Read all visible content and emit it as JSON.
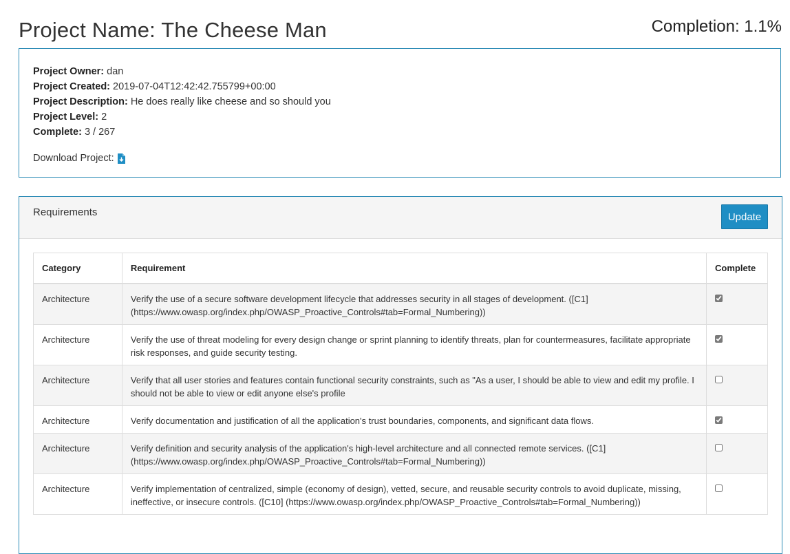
{
  "header": {
    "project_name": "Project Name: The Cheese Man",
    "completion": "Completion: 1.1%"
  },
  "project_info": {
    "owner_label": "Project Owner:",
    "owner_value": "dan",
    "created_label": "Project Created:",
    "created_value": "2019-07-04T12:42:42.755799+00:00",
    "description_label": "Project Description:",
    "description_value": "He does really like cheese and so should you",
    "level_label": "Project Level:",
    "level_value": "2",
    "complete_label": "Complete:",
    "complete_value": "3 / 267",
    "download_label": "Download Project:",
    "download_icon": "file-download-icon"
  },
  "requirements": {
    "title": "Requirements",
    "update_label": "Update",
    "columns": [
      "Category",
      "Requirement",
      "Complete"
    ],
    "rows": [
      {
        "category": "Architecture",
        "requirement": "Verify the use of a secure software development lifecycle that addresses security in all stages of development. ([C1] (https://www.owasp.org/index.php/OWASP_Proactive_Controls#tab=Formal_Numbering))",
        "complete": true
      },
      {
        "category": "Architecture",
        "requirement": "Verify the use of threat modeling for every design change or sprint planning to identify threats, plan for countermeasures, facilitate appropriate risk responses, and guide security testing.",
        "complete": true
      },
      {
        "category": "Architecture",
        "requirement": "Verify that all user stories and features contain functional security constraints, such as \"As a user, I should be able to view and edit my profile. I should not be able to view or edit anyone else's profile",
        "complete": false
      },
      {
        "category": "Architecture",
        "requirement": "Verify documentation and justification of all the application's trust boundaries, components, and significant data flows.",
        "complete": true
      },
      {
        "category": "Architecture",
        "requirement": "Verify definition and security analysis of the application's high-level architecture and all connected remote services. ([C1] (https://www.owasp.org/index.php/OWASP_Proactive_Controls#tab=Formal_Numbering))",
        "complete": false
      },
      {
        "category": "Architecture",
        "requirement": "Verify implementation of centralized, simple (economy of design), vetted, secure, and reusable security controls to avoid duplicate, missing, ineffective, or insecure controls. ([C10] (https://www.owasp.org/index.php/OWASP_Proactive_Controls#tab=Formal_Numbering))",
        "complete": false
      }
    ]
  },
  "colors": {
    "accent": "#1f8ec4",
    "panel_border": "#2a8ab5"
  }
}
